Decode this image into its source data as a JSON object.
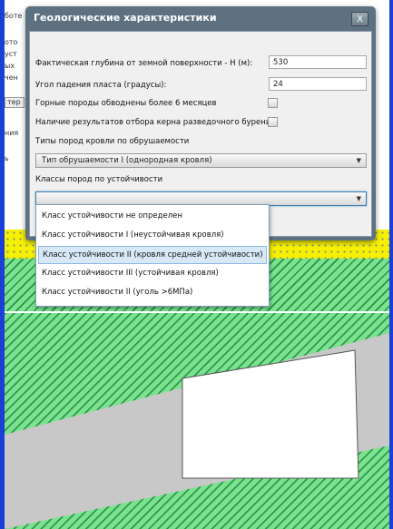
{
  "background_app": {
    "top_text": "боте",
    "side_text": [
      "ото",
      "уст",
      "ых",
      "чен"
    ],
    "button_label": "тер",
    "label_1": "ния",
    "label_2": "ь"
  },
  "dialog": {
    "title": "Геологические характеристики",
    "close_label": "X",
    "depth_label": "Фактическая глубина от земной поверхности - H (м):",
    "depth_value": "530",
    "angle_label": "Угол падения пласта (градусы):",
    "angle_value": "24",
    "watered_label": "Горные породы обводнены более 6 месяцев",
    "core_label": "Наличие результатов отбора керна разведочного бурения",
    "roof_types_label": "Типы пород кровли по обрушаемости",
    "roof_type_selected": "Тип обрушаемости  I  (однородная кровля)",
    "stability_label": "Классы пород по устойчивости",
    "stability_selected": ""
  },
  "dropdown": {
    "options": [
      "Класс устойчивости не определен",
      "Класс устойчивости  I  (неустойчивая кровля)",
      "Класс устойчивости  II  (кровля средней устойчивости)",
      "Класс устойчивости  III  (устойчивая кровля)",
      "Класс устойчивости  II  (уголь >6МПа)"
    ],
    "highlighted_index": 2
  },
  "colors": {
    "accent": "#1a3fd6",
    "dialog_frame": "#5d7180",
    "coal_green": "#7be38e",
    "sand_yellow": "#f5f000",
    "gallery_gray": "#c8c8c8"
  }
}
